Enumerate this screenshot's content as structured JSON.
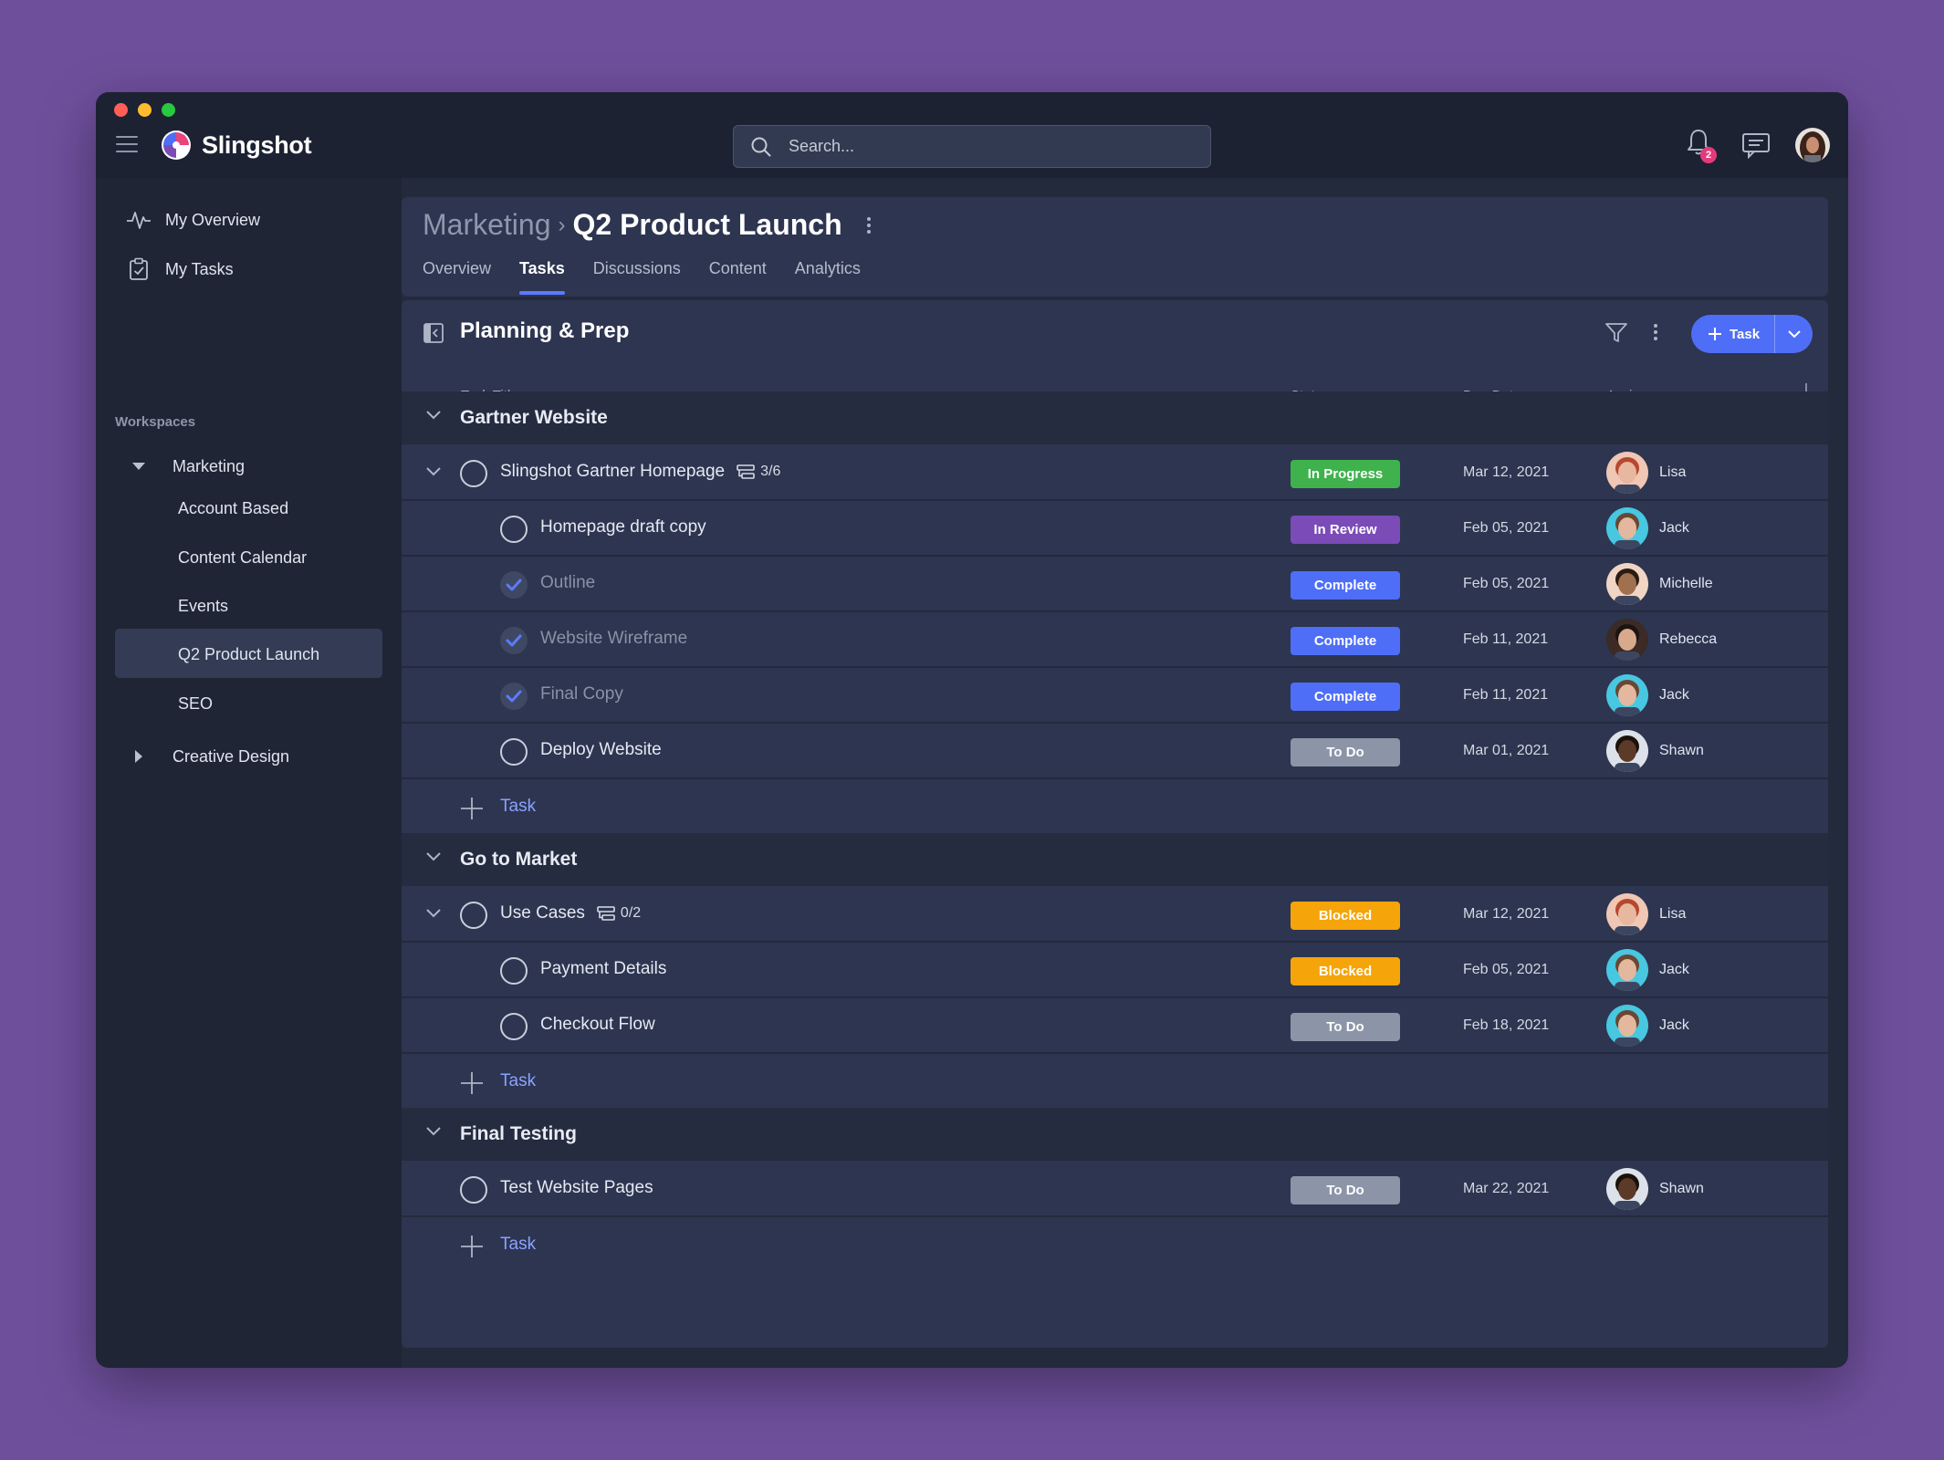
{
  "app": {
    "name": "Slingshot",
    "notifications_count": "2"
  },
  "search": {
    "placeholder": "Search..."
  },
  "sidebar": {
    "top_items": [
      {
        "label": "My Overview",
        "icon": "activity-icon"
      },
      {
        "label": "My Tasks",
        "icon": "clipboard-icon"
      }
    ],
    "workspaces_label": "Workspaces",
    "workspaces": [
      {
        "label": "Marketing",
        "expanded": true,
        "children": [
          "Account Based",
          "Content Calendar",
          "Events",
          "Q2 Product Launch",
          "SEO"
        ]
      },
      {
        "label": "Creative Design",
        "expanded": false
      }
    ],
    "active_item": "Q2 Product Launch"
  },
  "header": {
    "breadcrumb_parent": "Marketing",
    "title": "Q2 Product Launch",
    "tabs": [
      "Overview",
      "Tasks",
      "Discussions",
      "Content",
      "Analytics"
    ],
    "active_tab": "Tasks"
  },
  "list": {
    "title": "Planning & Prep",
    "add_button_label": "Task",
    "columns": {
      "title": "Task Title",
      "status": "Status",
      "due": "Due Date",
      "assignee": "Assignee"
    },
    "add_task_label": "Task",
    "groups": [
      {
        "name": "Gartner Website",
        "rows": [
          {
            "title": "Slingshot Gartner Homepage",
            "level": 0,
            "expandable": true,
            "subtasks": "3/6",
            "done": false,
            "status": "In Progress",
            "due": "Mar 12, 2021",
            "assignee": "Lisa"
          },
          {
            "title": "Homepage draft copy",
            "level": 1,
            "done": false,
            "status": "In Review",
            "due": "Feb 05, 2021",
            "assignee": "Jack"
          },
          {
            "title": "Outline",
            "level": 1,
            "done": true,
            "status": "Complete",
            "due": "Feb 05, 2021",
            "assignee": "Michelle"
          },
          {
            "title": "Website Wireframe",
            "level": 1,
            "done": true,
            "status": "Complete",
            "due": "Feb 11, 2021",
            "assignee": "Rebecca"
          },
          {
            "title": "Final Copy",
            "level": 1,
            "done": true,
            "status": "Complete",
            "due": "Feb 11, 2021",
            "assignee": "Jack"
          },
          {
            "title": "Deploy Website",
            "level": 1,
            "done": false,
            "status": "To Do",
            "due": "Mar 01, 2021",
            "assignee": "Shawn"
          }
        ]
      },
      {
        "name": "Go to Market",
        "rows": [
          {
            "title": "Use Cases",
            "level": 0,
            "expandable": true,
            "subtasks": "0/2",
            "done": false,
            "status": "Blocked",
            "due": "Mar 12, 2021",
            "assignee": "Lisa"
          },
          {
            "title": "Payment Details",
            "level": 1,
            "done": false,
            "status": "Blocked",
            "due": "Feb 05, 2021",
            "assignee": "Jack"
          },
          {
            "title": "Checkout Flow",
            "level": 1,
            "done": false,
            "status": "To Do",
            "due": "Feb 18, 2021",
            "assignee": "Jack"
          }
        ]
      },
      {
        "name": "Final Testing",
        "rows": [
          {
            "title": "Test Website Pages",
            "level": 0,
            "done": false,
            "status": "To Do",
            "due": "Mar 22, 2021",
            "assignee": "Shawn"
          }
        ]
      }
    ]
  },
  "status_colors": {
    "In Progress": "#3fb24d",
    "In Review": "#7b4bb8",
    "Complete": "#4f6ef7",
    "To Do": "#8c95a8",
    "Blocked": "#f5a40a"
  },
  "avatar_colors": {
    "Lisa": {
      "skin": "#e8b7a0",
      "hair": "#b5482f",
      "bg": "#f0c6b4"
    },
    "Jack": {
      "skin": "#e3b89e",
      "hair": "#6a4733",
      "bg": "#48c7e0"
    },
    "Michelle": {
      "skin": "#a0704f",
      "hair": "#2a1b14",
      "bg": "#f1d5c4"
    },
    "Rebecca": {
      "skin": "#d8a98c",
      "hair": "#1c1410",
      "bg": "#3b2a25"
    },
    "Shawn": {
      "skin": "#5b3a28",
      "hair": "#1b120c",
      "bg": "#dde2ea"
    }
  }
}
